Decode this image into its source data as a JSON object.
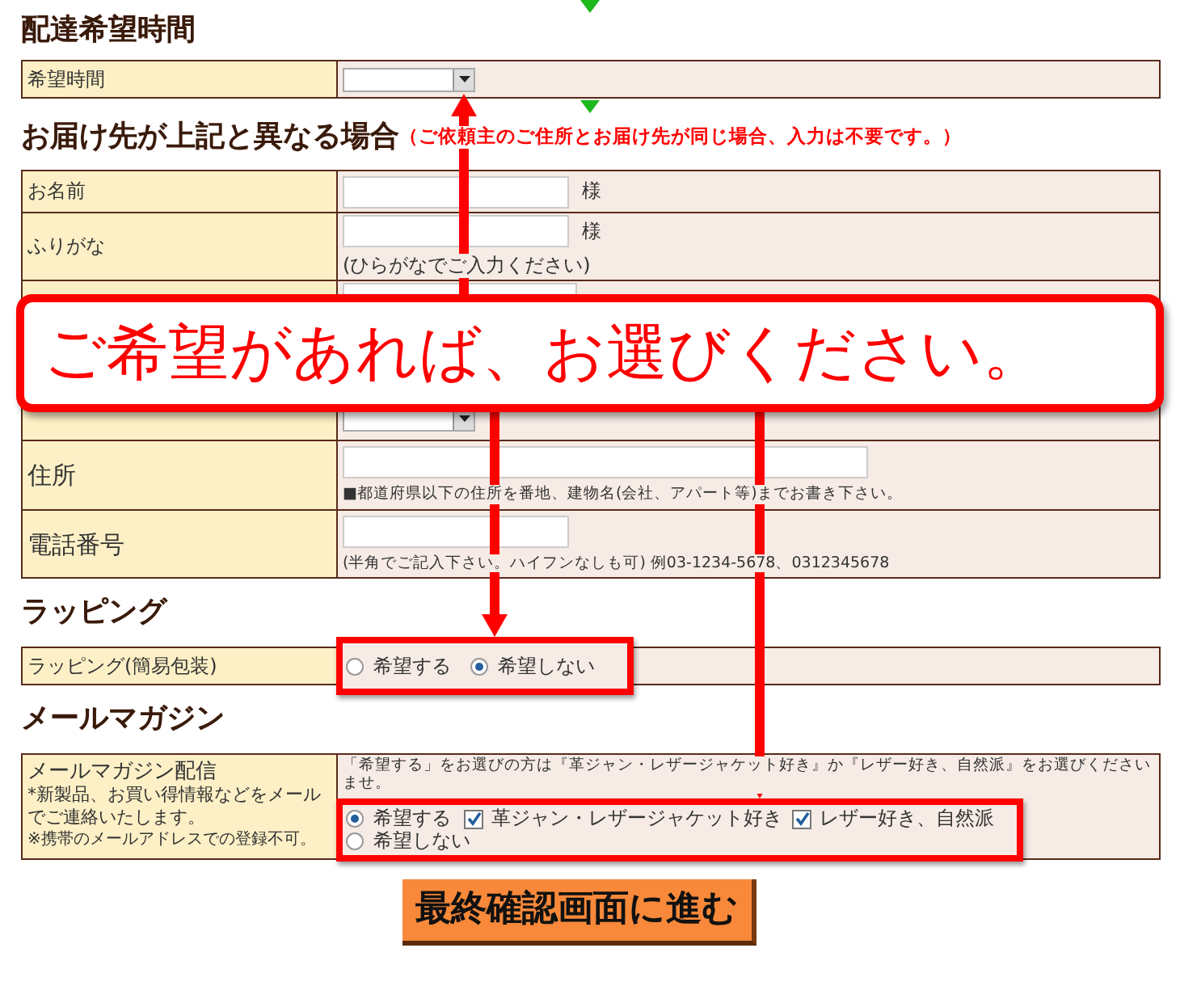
{
  "delivery_time": {
    "heading": "配達希望時間",
    "label": "希望時間"
  },
  "alt_address": {
    "heading": "お届け先が上記と異なる場合",
    "note": "（ご依頼主のご住所とお届け先が同じ場合、入力は不要です。）",
    "rows": [
      {
        "kind": "text",
        "label": "お名前",
        "suffix": "様"
      },
      {
        "kind": "text",
        "label": "ふりがな",
        "suffix": "様",
        "hint": "(ひらがなでご入力ください)"
      },
      {
        "kind": "covered"
      },
      {
        "kind": "select"
      },
      {
        "kind": "wide",
        "label": "住所",
        "hint": "■都道府県以下の住所を番地、建物名(会社、アパート等)までお書き下さい。"
      },
      {
        "kind": "text",
        "label": "電話番号",
        "hint": "(半角でご記入下さい。ハイフンなしも可) 例03-1234-5678、0312345678"
      }
    ]
  },
  "wrapping": {
    "heading": "ラッピング",
    "label": "ラッピング(簡易包装)",
    "options": [
      {
        "label": "希望する",
        "selected": false
      },
      {
        "label": "希望しない",
        "selected": true
      }
    ]
  },
  "newsletter": {
    "heading": "メールマガジン",
    "label": "メールマガジン配信",
    "description": "*新製品、お買い得情報などをメールでご連絡いたします。",
    "notice": "※携帯のメールアドレスでの登録不可。",
    "instruction": "「希望する」をお選びの方は『革ジャン・レザージャケット好き』か『レザー好き、自然派』をお選びくださいませ。",
    "options": [
      {
        "label": "希望する",
        "selected": true
      },
      {
        "label": "希望しない",
        "selected": false
      }
    ],
    "interests": [
      {
        "label": "革ジャン・レザージャケット好き",
        "checked": true
      },
      {
        "label": "レザー好き、自然派",
        "checked": true
      }
    ]
  },
  "callout": "ご希望があれば、お選びください。",
  "submit": "最終確認画面に進む"
}
